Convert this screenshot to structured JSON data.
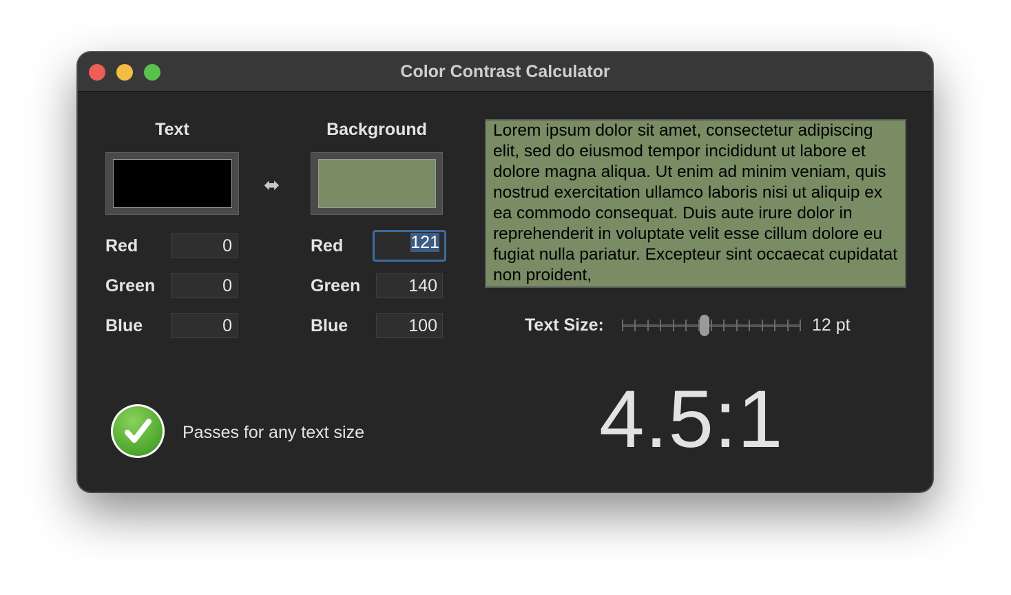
{
  "window": {
    "title": "Color Contrast Calculator"
  },
  "text_color": {
    "heading": "Text",
    "swatch_color": "#000000",
    "red_label": "Red",
    "green_label": "Green",
    "blue_label": "Blue",
    "red": "0",
    "green": "0",
    "blue": "0"
  },
  "background_color": {
    "heading": "Background",
    "swatch_color": "#798c64",
    "red_label": "Red",
    "green_label": "Green",
    "blue_label": "Blue",
    "red": "121",
    "green": "140",
    "blue": "100"
  },
  "swap_icon": "left-right-arrow-icon",
  "preview": {
    "text": "Lorem ipsum dolor sit amet, consectetur adipiscing elit, sed do eiusmod tempor incididunt ut labore et dolore magna aliqua. Ut enim ad minim veniam, quis nostrud exercitation ullamco laboris nisi ut aliquip ex ea commodo consequat. Duis aute irure dolor in reprehenderit in voluptate velit esse cillum dolore eu fugiat nulla pariatur. Excepteur sint occaecat cupidatat non proident,",
    "text_color": "#000000",
    "background_color": "#798c64"
  },
  "text_size": {
    "label": "Text Size:",
    "value": "12 pt",
    "slider_fraction": 0.46
  },
  "result": {
    "ratio": "4.5:1",
    "status": "Passes for any text size",
    "status_icon": "checkmark-circle-icon",
    "status_color": "#4fa52f"
  }
}
